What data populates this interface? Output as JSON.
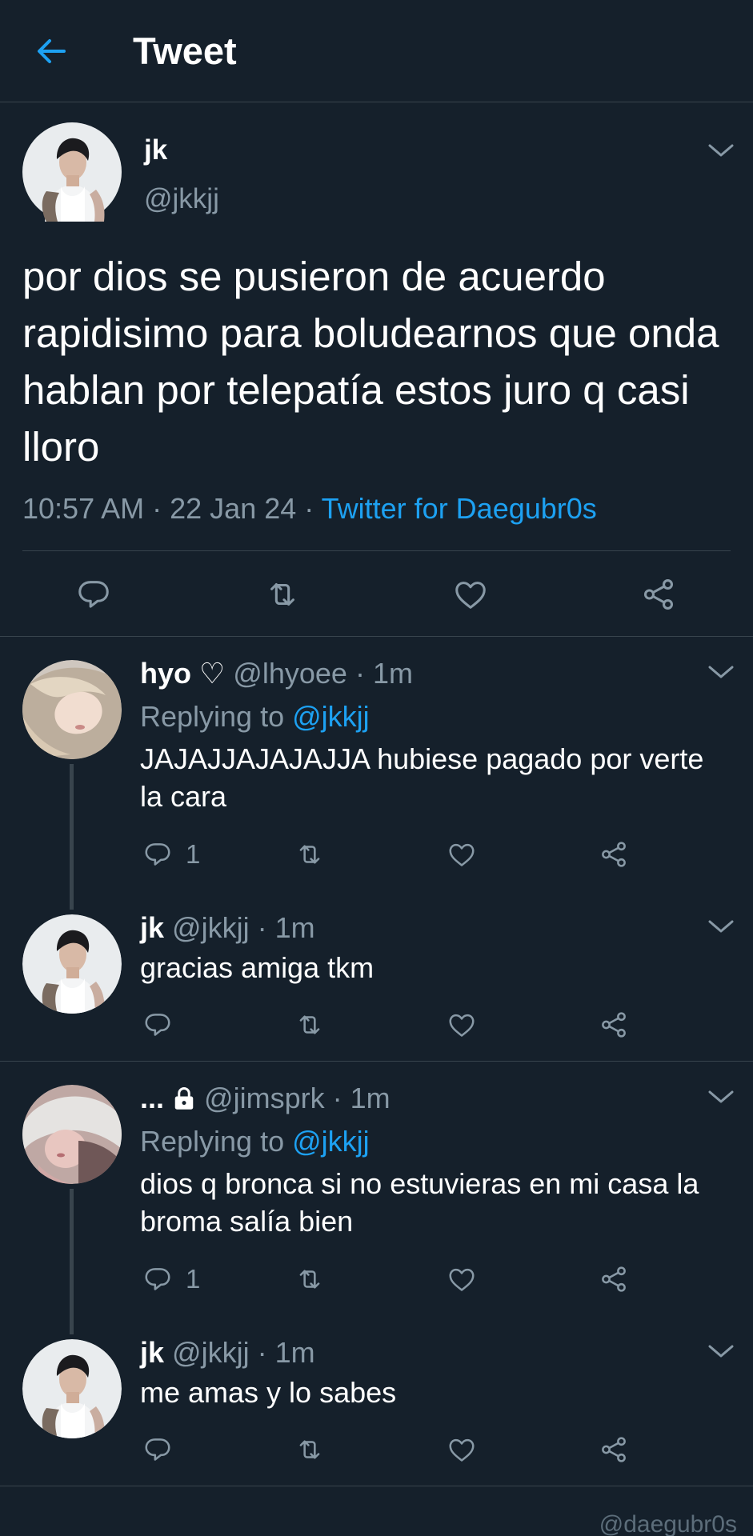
{
  "header": {
    "title": "Tweet"
  },
  "main_tweet": {
    "name": "jk",
    "handle": "@jkkjj",
    "text": "por dios se pusieron de acuerdo rapidisimo para boludearnos que onda hablan por telepatía estos juro q casi lloro",
    "time": "10:57 AM",
    "date": "22 Jan 24",
    "separator": "·",
    "source": "Twitter for Daegubr0s"
  },
  "replies": [
    {
      "name": "hyo ♡",
      "handle": "@lhyoee",
      "time": "1m",
      "replying_prefix": "Replying to",
      "replying_handle": "@jkkjj",
      "text": "JAJAJJAJAJAJJA hubiese pagado por verte la cara",
      "reply_count": "1"
    },
    {
      "name": "jk",
      "handle": "@jkkjj",
      "time": "1m",
      "text": "gracias amiga tkm"
    },
    {
      "name": "...",
      "handle": "@jimsprk",
      "time": "1m",
      "replying_prefix": "Replying to",
      "replying_handle": "@jkkjj",
      "text": "dios q bronca si no estuvieras en mi casa la broma salía bien",
      "reply_count": "1"
    },
    {
      "name": "jk",
      "handle": "@jkkjj",
      "time": "1m",
      "text": "me amas y lo sabes"
    }
  ],
  "watermark": "@daegubr0s",
  "colors": {
    "background": "#15202b",
    "accent": "#1da1f2",
    "muted": "#8899a6",
    "divider": "#38444d"
  },
  "icons": [
    "back-arrow-icon",
    "chevron-down-icon",
    "reply-icon",
    "retweet-icon",
    "like-icon",
    "share-icon",
    "lock-icon"
  ]
}
